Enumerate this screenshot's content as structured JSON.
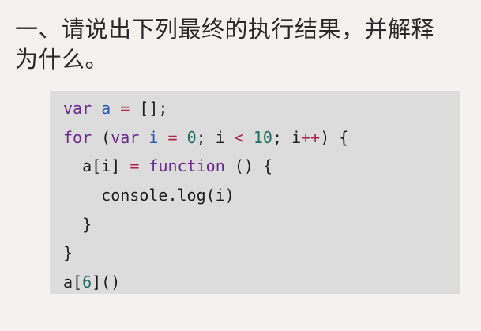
{
  "question": {
    "text": "一、请说出下列最终的执行结果，并解释为什么。"
  },
  "code": {
    "l1": {
      "kw": "var",
      "sp1": " ",
      "id": "a",
      "sp2": " ",
      "op": "=",
      "rest": " [];"
    },
    "l2": {
      "kw1": "for",
      "p1": " (",
      "kw2": "var",
      "sp1": " ",
      "id": "i",
      "sp2": " ",
      "op1": "=",
      "sp3": " ",
      "num1": "0",
      "p2": "; i ",
      "op2": "<",
      "sp4": " ",
      "num2": "10",
      "p3": "; i",
      "op3": "++",
      "p4": ") {"
    },
    "l3": {
      "indent": "  ",
      "p1": "a[i] ",
      "op": "=",
      "sp": " ",
      "kw": "function",
      "p2": " () {"
    },
    "l4": {
      "indent": "    ",
      "text": "console.log(i)"
    },
    "l5": {
      "indent": "  ",
      "text": "}"
    },
    "l6": {
      "text": "}"
    },
    "l7": {
      "p1": "a[",
      "num": "6",
      "p2": "]()"
    }
  }
}
